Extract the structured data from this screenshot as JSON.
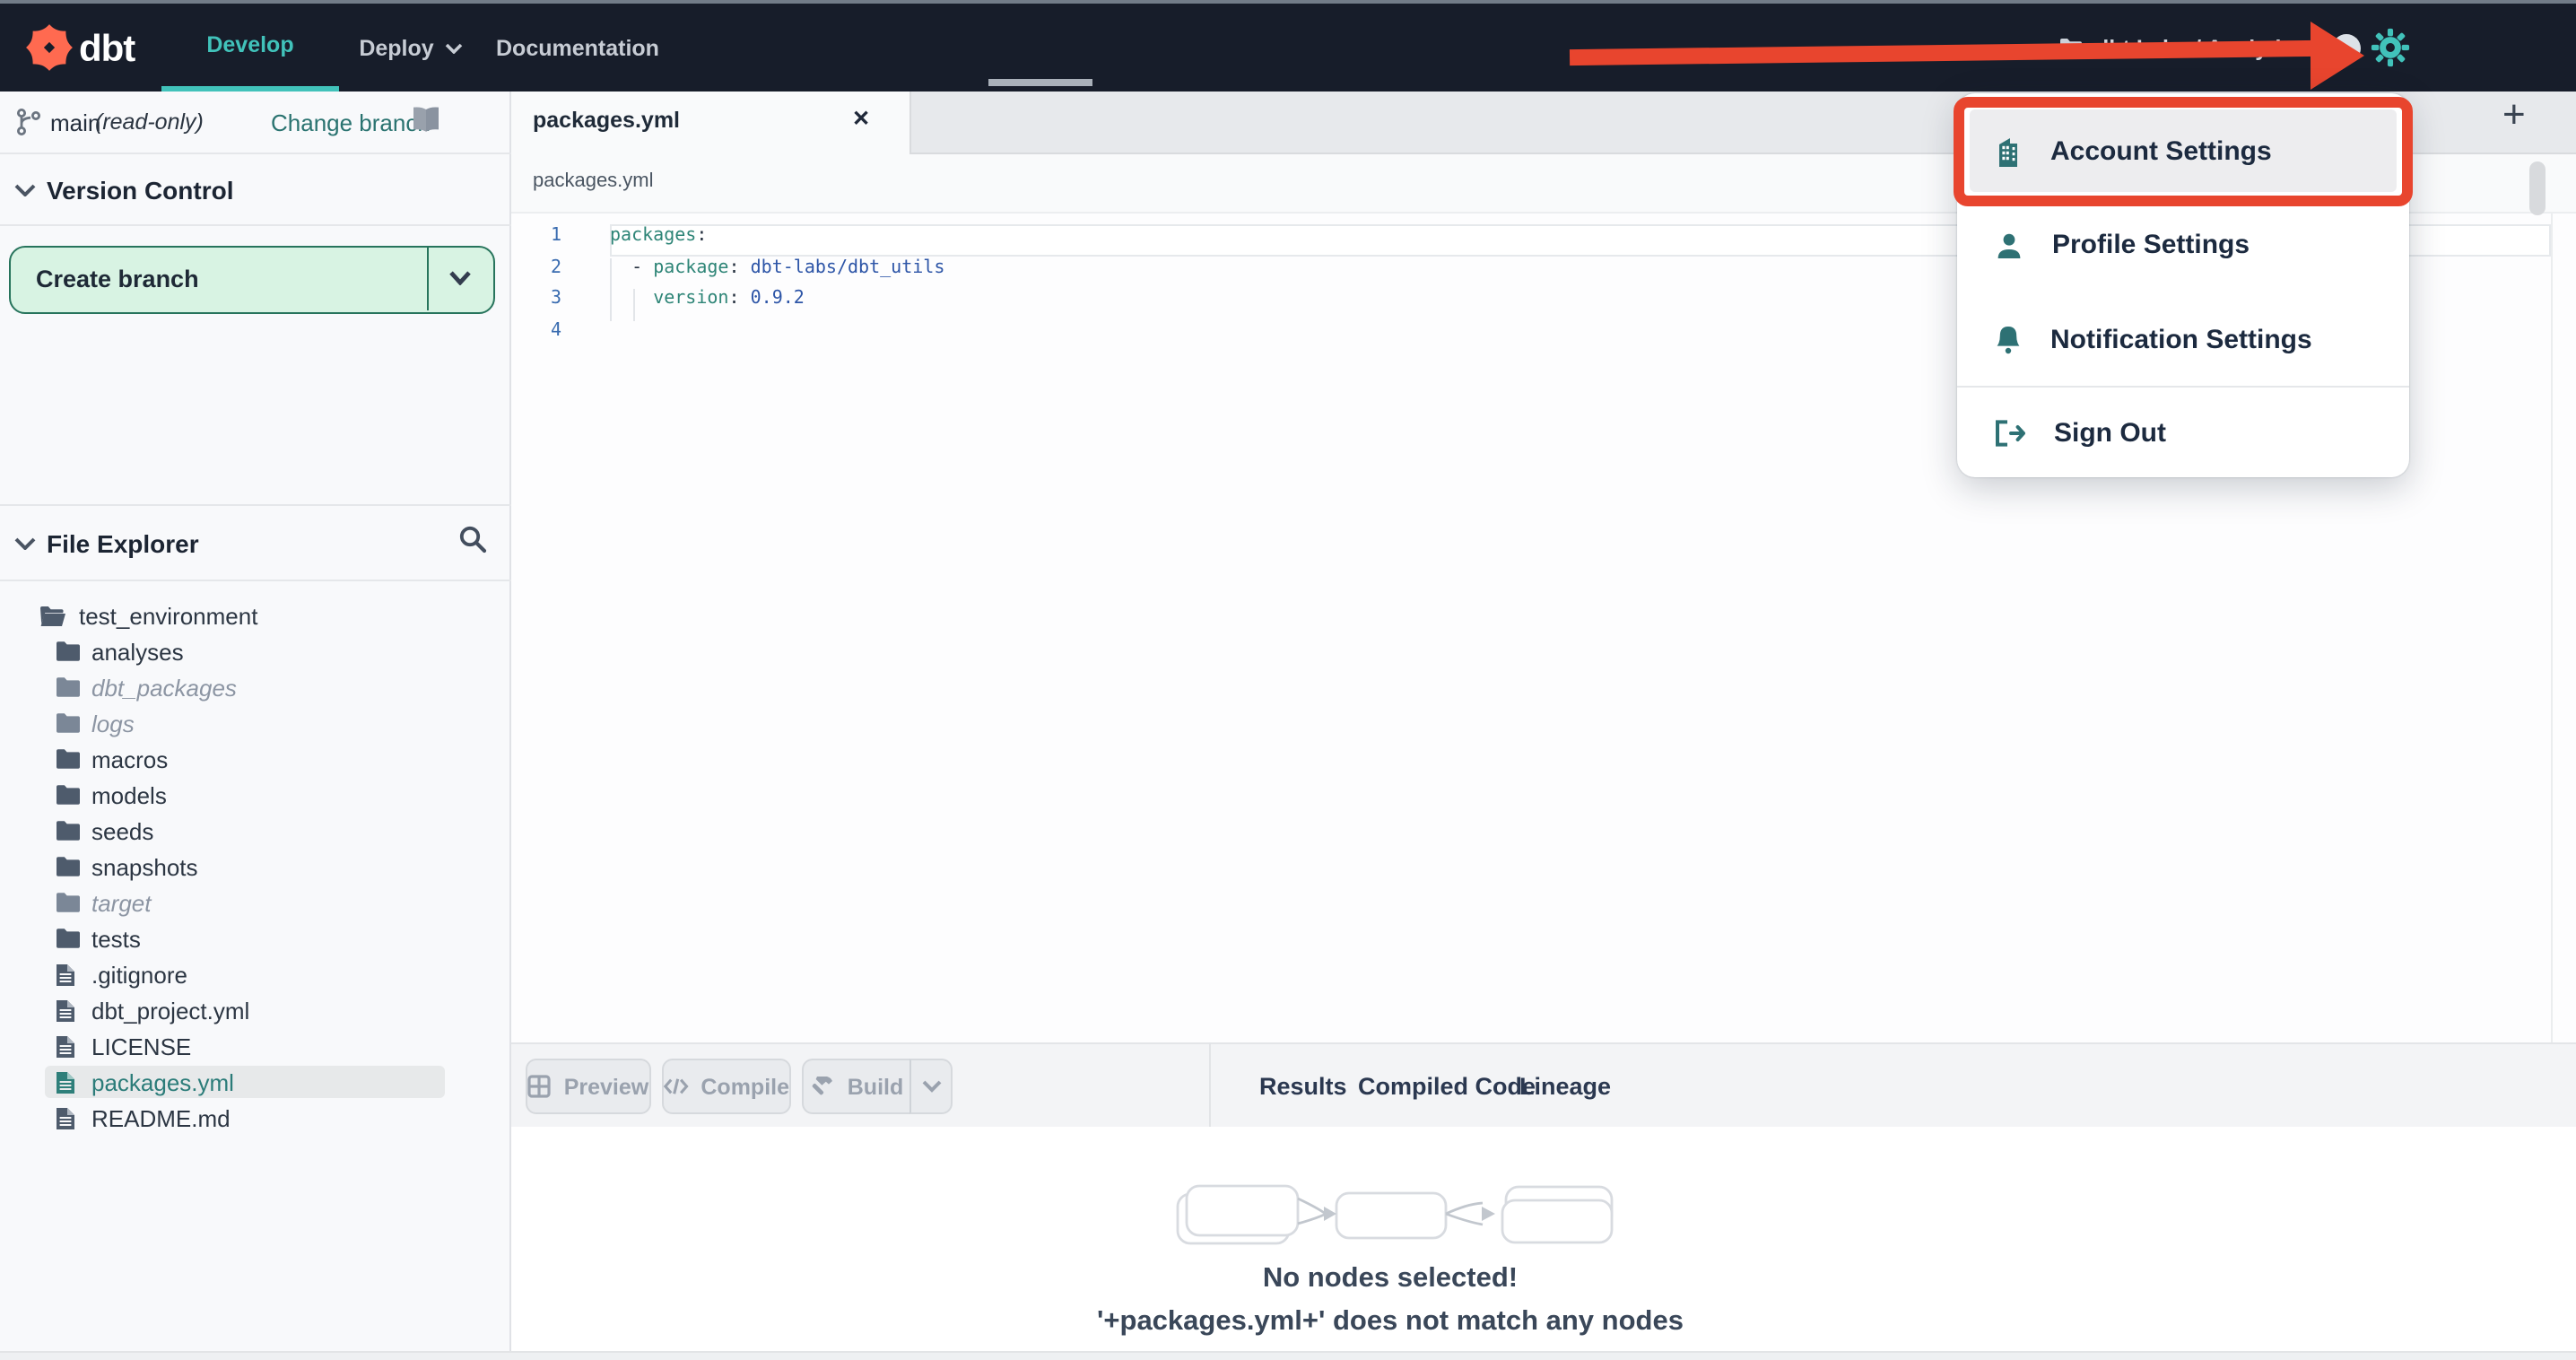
{
  "navbar": {
    "brand": "dbt",
    "items": [
      {
        "label": "Develop",
        "active": true
      },
      {
        "label": "Deploy",
        "caret": true
      },
      {
        "label": "Documentation"
      }
    ],
    "account_label": "dbt Labs / Analytics"
  },
  "menu": {
    "items": [
      {
        "label": "Account Settings",
        "icon": "building-icon",
        "highlighted": true
      },
      {
        "label": "Profile Settings",
        "icon": "user-icon"
      },
      {
        "label": "Notification Settings",
        "icon": "bell-icon"
      },
      {
        "label": "Sign Out",
        "icon": "sign-out-icon",
        "divider_before": true
      }
    ]
  },
  "sidebar": {
    "branch": {
      "name": "main",
      "mode": "(read-only)",
      "change_link": "Change branch"
    },
    "version_control_title": "Version Control",
    "create_branch_label": "Create branch",
    "file_explorer_title": "File Explorer",
    "files": [
      {
        "label": "test_environment",
        "type": "folder-open",
        "root": true
      },
      {
        "label": "analyses",
        "type": "folder"
      },
      {
        "label": "dbt_packages",
        "type": "folder",
        "ghosted": true
      },
      {
        "label": "logs",
        "type": "folder",
        "ghosted": true
      },
      {
        "label": "macros",
        "type": "folder"
      },
      {
        "label": "models",
        "type": "folder"
      },
      {
        "label": "seeds",
        "type": "folder"
      },
      {
        "label": "snapshots",
        "type": "folder"
      },
      {
        "label": "target",
        "type": "folder",
        "ghosted": true
      },
      {
        "label": "tests",
        "type": "folder"
      },
      {
        "label": ".gitignore",
        "type": "file"
      },
      {
        "label": "dbt_project.yml",
        "type": "file"
      },
      {
        "label": "LICENSE",
        "type": "file"
      },
      {
        "label": "packages.yml",
        "type": "file",
        "selected": true
      },
      {
        "label": "README.md",
        "type": "file"
      }
    ]
  },
  "editor": {
    "tab_label": "packages.yml",
    "close_glyph": "✕",
    "new_tab_glyph": "+",
    "breadcrumb": "packages.yml",
    "lines": [
      {
        "num": "1",
        "parts": [
          {
            "text": "packages",
            "cls": "k"
          },
          {
            "text": ":",
            "cls": "p"
          }
        ]
      },
      {
        "num": "2",
        "parts": [
          {
            "text": "  - ",
            "cls": "p"
          },
          {
            "text": "package",
            "cls": "k"
          },
          {
            "text": ":",
            "cls": "p"
          },
          {
            "text": " ",
            "cls": "p"
          },
          {
            "text": "dbt-labs/dbt_utils",
            "cls": "v"
          }
        ]
      },
      {
        "num": "3",
        "parts": [
          {
            "text": "    ",
            "cls": "p"
          },
          {
            "text": "version",
            "cls": "k"
          },
          {
            "text": ":",
            "cls": "p"
          },
          {
            "text": " ",
            "cls": "p"
          },
          {
            "text": "0.9.2",
            "cls": "v"
          }
        ]
      },
      {
        "num": "4",
        "parts": []
      }
    ]
  },
  "actions": {
    "preview": "Preview",
    "compile": "Compile",
    "build": "Build"
  },
  "panel": {
    "tabs": [
      {
        "label": "Results"
      },
      {
        "label": "Compiled Code"
      },
      {
        "label": "Lineage",
        "active": true
      }
    ]
  },
  "lineage": {
    "message_title": "No nodes selected!",
    "message_detail": "'+packages.yml+' does not match any nodes"
  },
  "colors": {
    "navbar_bg": "#171d2a",
    "accent_teal": "#41c2ba",
    "link_teal": "#2a7370",
    "menu_icon_teal": "#2e7174",
    "annotation_red": "#e8452e",
    "create_branch_bg": "#d8f3e3",
    "create_branch_border": "#27745c",
    "code_key": "#2e8577",
    "code_value": "#2d55a7",
    "line_number": "#3a6cb0"
  }
}
